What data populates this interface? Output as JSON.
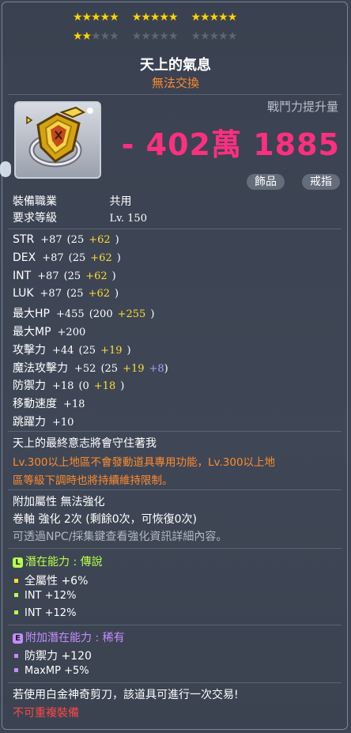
{
  "stars": {
    "total": 15,
    "filled_row1": 15,
    "filled_row2": 2,
    "total_row2": 15
  },
  "item": {
    "name": "天上的氣息",
    "trade": "無法交換",
    "icon": "golden-shield-ring-icon"
  },
  "combat_power": {
    "label": "戰鬥力提升量",
    "value": "- 402萬 1885"
  },
  "tags": [
    "飾品",
    "戒指"
  ],
  "requirements": [
    {
      "label": "裝備職業",
      "value": "共用"
    },
    {
      "label": "要求等級",
      "value": "Lv. 150"
    }
  ],
  "stats": [
    {
      "name": "STR",
      "total": "+87",
      "base": "(25",
      "bonus": "+62",
      "extra": "",
      "close": ")"
    },
    {
      "name": "DEX",
      "total": "+87",
      "base": "(25",
      "bonus": "+62",
      "extra": "",
      "close": ")"
    },
    {
      "name": "INT",
      "total": "+87",
      "base": "(25",
      "bonus": "+62",
      "extra": "",
      "close": ")"
    },
    {
      "name": "LUK",
      "total": "+87",
      "base": "(25",
      "bonus": "+62",
      "extra": "",
      "close": ")"
    },
    {
      "name": "最大HP",
      "total": "+455",
      "base": "(200",
      "bonus": "+255",
      "extra": "",
      "close": ")"
    },
    {
      "name": "最大MP",
      "total": "+200",
      "base": "",
      "bonus": "",
      "extra": "",
      "close": ""
    },
    {
      "name": "攻擊力",
      "total": "+44",
      "base": "(25",
      "bonus": "+19",
      "extra": "",
      "close": ")"
    },
    {
      "name": "魔法攻擊力",
      "total": "+52",
      "base": "(25",
      "bonus": "+19",
      "extra": "+8",
      "close": ")"
    },
    {
      "name": "防禦力",
      "total": "+18",
      "base": "(0",
      "bonus": "+18",
      "extra": "",
      "close": ")"
    },
    {
      "name": "移動速度",
      "total": "+18",
      "base": "",
      "bonus": "",
      "extra": "",
      "close": ""
    },
    {
      "name": "跳躍力",
      "total": "+10",
      "base": "",
      "bonus": "",
      "extra": "",
      "close": ""
    }
  ],
  "description": {
    "line1": "天上的最終意志將會守住著我",
    "line2": "Lv.300以上地區不會發動道具專用功能，Lv.300以上地",
    "line3": "區等級下調時也將持續維持限制。"
  },
  "attributes": {
    "line1": "附加屬性 無法強化",
    "line2": "卷軸 強化 2次 (剩餘0次，可恢復0次)",
    "line3": "可透過NPC/採集鍵查看強化資訊詳細內容。"
  },
  "potential": {
    "badge": "L",
    "title": "潛在能力 : 傳說",
    "lines": [
      "全屬性 +6%",
      "INT +12%",
      "INT +12%"
    ],
    "color": "#b6ff4c"
  },
  "bonus_potential": {
    "badge": "E",
    "title": "附加潛在能力 : 稀有",
    "lines": [
      "防禦力 +120",
      "MaxMP +5%"
    ],
    "color": "#c38dff"
  },
  "footer": {
    "line1": "若使用白金神奇剪刀，該道具可進行一次交易!",
    "line2": "不可重複裝備"
  }
}
